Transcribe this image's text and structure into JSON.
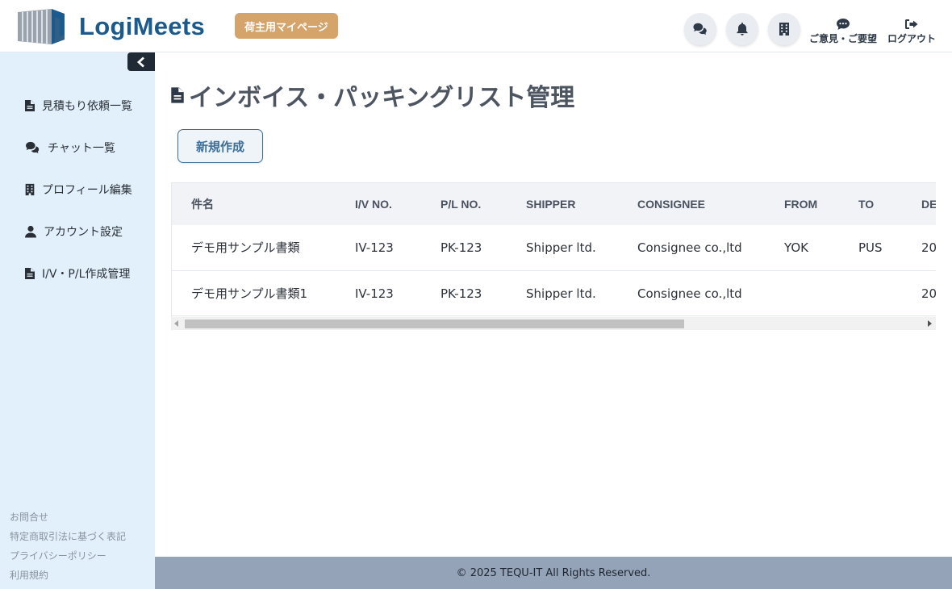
{
  "header": {
    "brand": "LogiMeets",
    "role_badge": "荷主用マイページ",
    "icons": [
      "chat-icon",
      "bell-icon",
      "building-icon"
    ],
    "feedback_label": "ご意見・ご要望",
    "logout_label": "ログアウト"
  },
  "sidebar": {
    "items": [
      {
        "label": "見積もり依頼一覧",
        "icon": "document-icon"
      },
      {
        "label": "チャット一覧",
        "icon": "chat-icon"
      },
      {
        "label": "プロフィール編集",
        "icon": "building-icon"
      },
      {
        "label": "アカウント設定",
        "icon": "user-icon"
      },
      {
        "label": "I/V・P/L作成管理",
        "icon": "document-icon"
      }
    ],
    "footer_links": [
      "お問合せ",
      "特定商取引法に基づく表記",
      "プライバシーポリシー",
      "利用規約"
    ]
  },
  "main": {
    "title": "インボイス・パッキングリスト管理",
    "new_button": "新規作成",
    "table": {
      "columns": [
        "件名",
        "I/V NO.",
        "P/L NO.",
        "SHIPPER",
        "CONSIGNEE",
        "FROM",
        "TO",
        "DE"
      ],
      "rows": [
        [
          "デモ用サンプル書類",
          "IV-123",
          "PK-123",
          "Shipper ltd.",
          "Consignee co.,ltd",
          "YOK",
          "PUS",
          "20"
        ],
        [
          "デモ用サンプル書類1",
          "IV-123",
          "PK-123",
          "Shipper ltd.",
          "Consignee co.,ltd",
          "",
          "",
          "20"
        ]
      ]
    }
  },
  "footer": {
    "copyright": "© 2025 TEQU-IT All Rights Reserved."
  },
  "colors": {
    "brand": "#1b5a8c",
    "badge": "#d4a46a",
    "sidebar_bg": "#e2f0fb",
    "footer_bg": "#95a3b9"
  }
}
